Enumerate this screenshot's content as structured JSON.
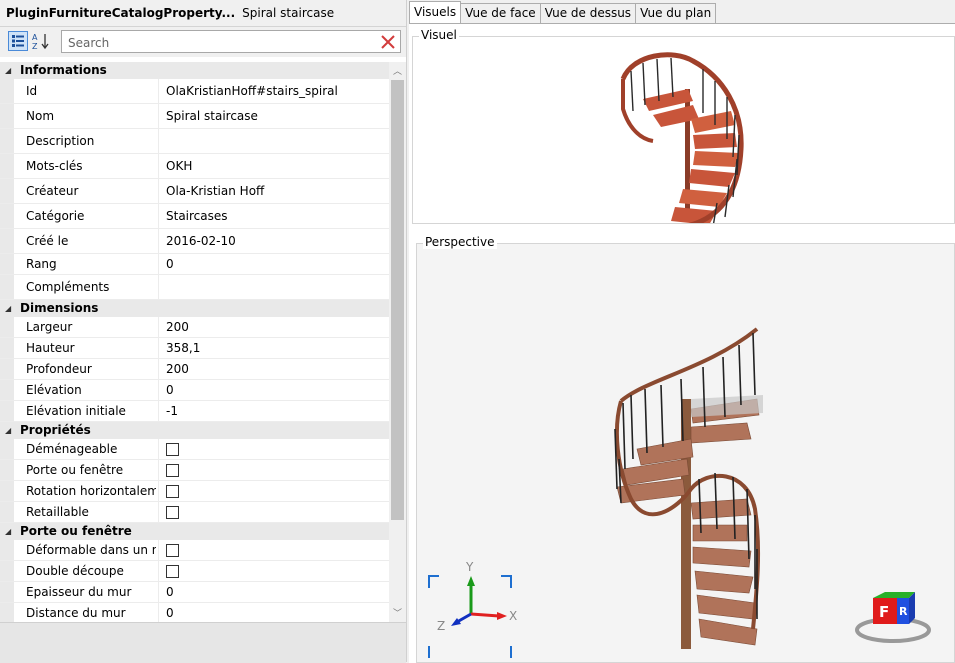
{
  "header": {
    "class_name": "PluginFurnitureCatalogProperty...",
    "object_name": "Spiral staircase"
  },
  "toolbar": {
    "search_placeholder": "Search"
  },
  "categories": [
    {
      "label": "Informations",
      "rows": [
        {
          "key": "Id",
          "value": "OlaKristianHoff#stairs_spiral"
        },
        {
          "key": "Nom",
          "value": "Spiral staircase"
        },
        {
          "key": "Description",
          "value": ""
        },
        {
          "key": "Mots-clés",
          "value": "OKH"
        },
        {
          "key": "Créateur",
          "value": "Ola-Kristian Hoff"
        },
        {
          "key": "Catégorie",
          "value": "Staircases"
        },
        {
          "key": "Créé le",
          "value": "2016-02-10"
        },
        {
          "key": "Rang",
          "value": "0"
        },
        {
          "key": "Compléments",
          "value": ""
        }
      ]
    },
    {
      "label": "Dimensions",
      "rows": [
        {
          "key": "Largeur",
          "value": "200"
        },
        {
          "key": "Hauteur",
          "value": "358,1"
        },
        {
          "key": "Profondeur",
          "value": "200"
        },
        {
          "key": "Elévation",
          "value": "0"
        },
        {
          "key": "Elévation initiale",
          "value": "-1"
        }
      ]
    },
    {
      "label": "Propriétés",
      "rows": [
        {
          "key": "Déménageable",
          "checked": false
        },
        {
          "key": "Porte ou fenêtre",
          "checked": false
        },
        {
          "key": "Rotation horizontalem...",
          "checked": false
        },
        {
          "key": "Retaillable",
          "checked": false
        }
      ]
    },
    {
      "label": "Porte ou fenêtre",
      "rows": [
        {
          "key": "Déformable dans un m...",
          "checked": false
        },
        {
          "key": "Double découpe",
          "checked": false
        },
        {
          "key": "Epaisseur du mur",
          "value": "0"
        },
        {
          "key": "Distance du mur",
          "value": "0"
        }
      ]
    }
  ],
  "tabs": [
    {
      "label": "Visuels",
      "active": true
    },
    {
      "label": "Vue de face",
      "active": false
    },
    {
      "label": "Vue de dessus",
      "active": false
    },
    {
      "label": "Vue du plan",
      "active": false
    }
  ],
  "panels": {
    "visual_title": "Visuel",
    "perspective_title": "Perspective"
  },
  "axes": {
    "x": "X",
    "y": "Y",
    "z": "Z"
  },
  "navcube": {
    "front": "F",
    "right": "R"
  },
  "colors": {
    "stair_wood": "#b0735a",
    "visual_wood": "#c8553a",
    "axis_x": "#e02020",
    "axis_y": "#1a9a1a",
    "axis_z": "#1030c0",
    "accent": "#4a8ad8"
  },
  "icons": [
    "categorized-sort-icon",
    "alphabetical-sort-icon",
    "clear-search-icon"
  ]
}
